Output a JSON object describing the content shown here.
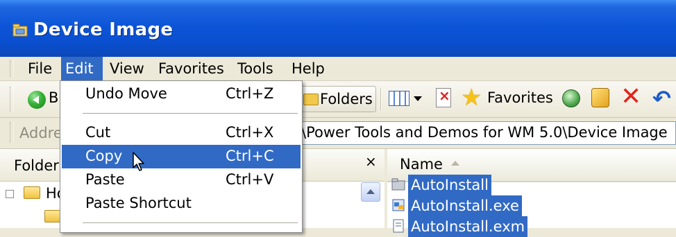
{
  "window": {
    "title": "Device Image",
    "title_icon": "folder-window-icon"
  },
  "menubar": {
    "items": [
      {
        "label": "File",
        "active": false
      },
      {
        "label": "Edit",
        "active": true
      },
      {
        "label": "View",
        "active": false
      },
      {
        "label": "Favorites",
        "active": false
      },
      {
        "label": "Tools",
        "active": false
      },
      {
        "label": "Help",
        "active": false
      }
    ]
  },
  "toolbar": {
    "back_label": "B",
    "folders_label": "Folders",
    "favorites_label": "Favorites",
    "icons": [
      "back-arrow-icon",
      "folders-icon",
      "views-icon",
      "delete-icon",
      "favorites-star-icon",
      "history-icon",
      "media-icon",
      "close-x-icon",
      "undo-icon"
    ]
  },
  "address": {
    "label": "Addre",
    "value": "\\Power Tools and Demos for WM 5.0\\Device Image"
  },
  "folders_pane": {
    "title": "Folder",
    "close_glyph": "×",
    "tree_item_label": "Ho"
  },
  "filelist": {
    "column_name": "Name",
    "files": [
      {
        "name": "AutoInstall",
        "icon": "folder-icon"
      },
      {
        "name": "AutoInstall.exe",
        "icon": "exe-icon"
      },
      {
        "name": "AutoInstall.exm",
        "icon": "document-icon"
      }
    ]
  },
  "edit_menu": {
    "undo": {
      "label": "Undo Move",
      "shortcut": "Ctrl+Z"
    },
    "cut": {
      "label": "Cut",
      "shortcut": "Ctrl+X"
    },
    "copy": {
      "label": "Copy",
      "shortcut": "Ctrl+C",
      "highlighted": true
    },
    "paste": {
      "label": "Paste",
      "shortcut": "Ctrl+V"
    },
    "paste_shortcut": {
      "label": "Paste Shortcut",
      "shortcut": ""
    }
  },
  "colors": {
    "title_blue": "#0a4fcf",
    "highlight": "#316ac5",
    "chrome": "#ece9d8"
  }
}
